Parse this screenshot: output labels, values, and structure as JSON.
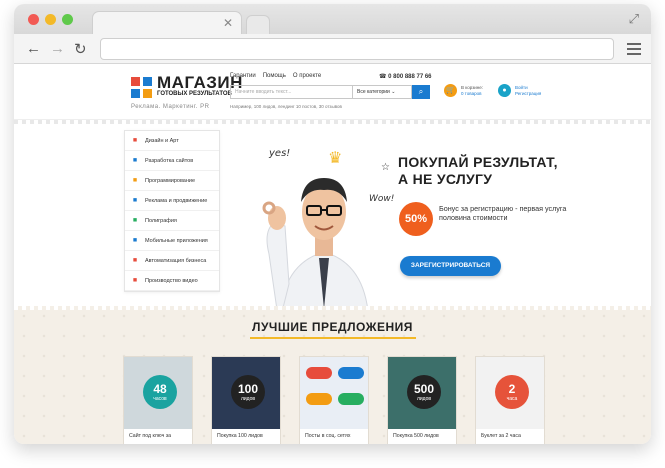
{
  "site": {
    "logo_title": "МАГАЗИН",
    "logo_subtitle": "ГОТОВЫХ РЕЗУЛЬТАТОВ",
    "tagline": "Реклама. Маркетинг. PR",
    "nav": [
      "Гарантии",
      "Помощь",
      "О проекте"
    ],
    "phone": "0 800 888 77 66",
    "search_placeholder": "Начните вводить текст...",
    "search_category": "Все категории",
    "example_text": "Например, 100 лидов, лендинг 10 постов, 30 отзывов",
    "cart_label": "В корзине:",
    "cart_value": "0 товаров",
    "login_label": "Войти",
    "register_label": "Регистрация"
  },
  "sidebar": {
    "items": [
      {
        "label": "Дизайн и Арт",
        "icon": "pencil-icon",
        "color": "#e74c3c"
      },
      {
        "label": "Разработка сайтов",
        "icon": "monitor-icon",
        "color": "#1a7bd0"
      },
      {
        "label": "Программирование",
        "icon": "code-icon",
        "color": "#f39c12"
      },
      {
        "label": "Реклама и продвижение",
        "icon": "megaphone-icon",
        "color": "#1a7bd0"
      },
      {
        "label": "Полиграфия",
        "icon": "image-icon",
        "color": "#27ae60"
      },
      {
        "label": "Мобильные приложения",
        "icon": "phone-icon",
        "color": "#1a7bd0"
      },
      {
        "label": "Автоматизация бизнеса",
        "icon": "briefcase-icon",
        "color": "#e74c3c"
      },
      {
        "label": "Производство видео",
        "icon": "gear-icon",
        "color": "#e74c3c"
      }
    ]
  },
  "hero": {
    "heading_line1": "ПОКУПАЙ РЕЗУЛЬТАТ,",
    "heading_line2": "А НЕ УСЛУГУ",
    "badge": "50%",
    "bonus_text": "Бонус за регистрацию - первая услуга половина стоимости",
    "register_button": "ЗАРЕГИСТРИРОВАТЬСЯ",
    "doodle_yes": "yes!",
    "doodle_wow": "Wow!"
  },
  "deals": {
    "title": "ЛУЧШИЕ ПРЕДЛОЖЕНИЯ",
    "cards": [
      {
        "label": "Сайт под ключ за",
        "badge_num": "48",
        "badge_sub": "часов",
        "bg": "#cfd8dc",
        "circle": "#1aa3a0"
      },
      {
        "label": "Покупка 100 лидов",
        "badge_num": "100",
        "badge_sub": "лидов",
        "bg": "#2b3a55",
        "circle": "#222"
      },
      {
        "label": "Посты в соц. сетях",
        "badge_num": "",
        "badge_sub": "",
        "bg": "#e9eef5",
        "circle": ""
      },
      {
        "label": "Покупка 500 лидов",
        "badge_num": "500",
        "badge_sub": "лидов",
        "bg": "#3c6f6a",
        "circle": "#222"
      },
      {
        "label": "Буклет за 2 часа",
        "badge_num": "2",
        "badge_sub": "часа",
        "bg": "#f2f2f2",
        "circle": "#e6533a"
      }
    ]
  }
}
